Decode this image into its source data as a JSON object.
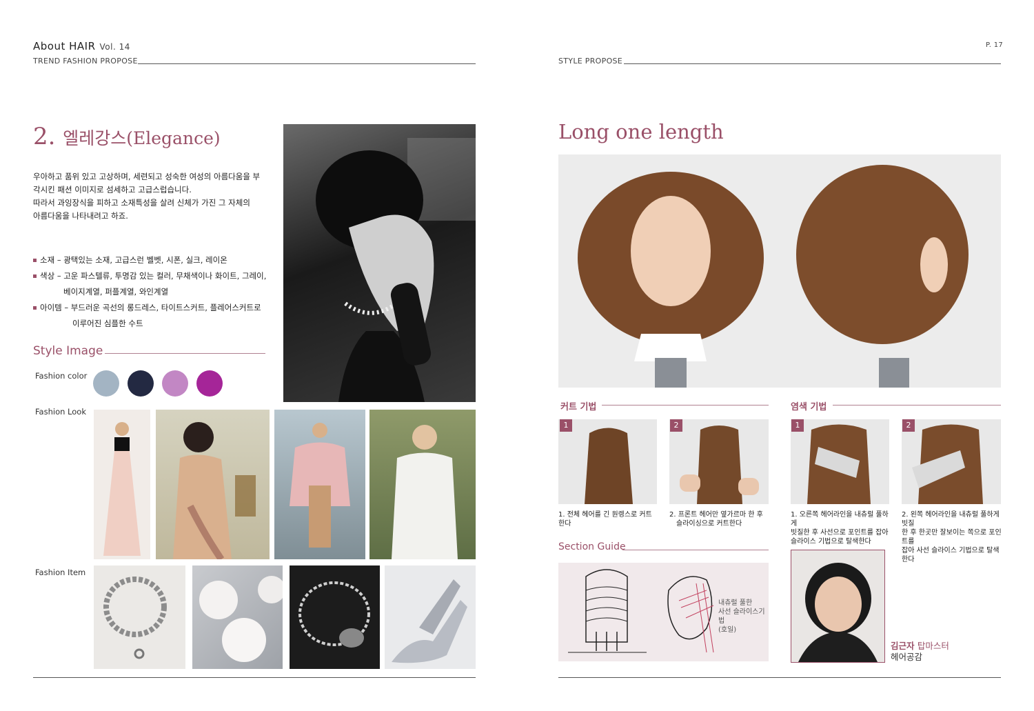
{
  "header_left": {
    "brand": "About HAIR",
    "volume": "Vol. 14",
    "subtitle": "TREND FASHION PROPOSE"
  },
  "header_right": {
    "page": "P. 17",
    "subtitle": "STYLE PROPOSE"
  },
  "left": {
    "heading_number": "2.",
    "heading_text": "엘레강스(Elegance)",
    "intro_lines": [
      "우아하고 품위 있고 고상하며, 세련되고 성숙한 여성의 아름다움을 부",
      "각시킨 패션 이미지로 섬세하고 고급스럽습니다.",
      "따라서 과잉장식을 피하고 소재특성을 살려 신체가 가진 그 자체의",
      "아름다움을 나타내려고 하죠."
    ],
    "bullets": [
      {
        "text": "소재 – 광택있는 소재, 고급스런 벨벳, 시폰, 실크, 레이온",
        "cont": ""
      },
      {
        "text": "색상 – 고운 파스텔류, 투명감 있는 컬러, 무채색이나 화이트, 그레이,",
        "cont": "베이지계열, 퍼플계열, 와인계열"
      },
      {
        "text": "아이템 – 부드러운 곡선의 롱드레스, 타이트스커트, 플레어스커트로",
        "cont": "이루어진 심플한 수트"
      }
    ],
    "style_image_title": "Style Image",
    "fashion_color_label": "Fashion color",
    "fashion_look_label": "Fashion Look",
    "fashion_item_label": "Fashion Item",
    "colors": [
      "#a3b4c3",
      "#232942",
      "#c287c4",
      "#a52598"
    ]
  },
  "right": {
    "title": "Long one length",
    "cut_heading": "커트 기법",
    "color_heading": "염색 기법",
    "cut_steps": [
      {
        "num": "1",
        "caption_lines": [
          "1. 전체 헤어를 긴 원렝스로 커트한다"
        ]
      },
      {
        "num": "2",
        "caption_lines": [
          "2. 프론트 헤어만 옆가르마 한 후",
          "슬라이싱으로 커트한다"
        ]
      }
    ],
    "color_steps": [
      {
        "num": "1",
        "caption_lines": [
          "1. 오른쪽 헤어라인을 내츄럴 풀하게",
          "빗질한 후 사선으로 포인트를 잡아",
          "슬라이스 기법으로 탈색한다"
        ]
      },
      {
        "num": "2",
        "caption_lines": [
          "2. 왼쪽 헤어라인을 내츄럴 풀하게 빗질",
          "한 후 한곳만 잘보이는 쪽으로 포인트를",
          "잡아 사선 슬라이스 기법으로 탈색한다"
        ]
      }
    ],
    "section_guide_title": "Section Guide",
    "guide_note_lines": [
      "내츄럴 풀한",
      "사선 슬라이스기법",
      "(호일)"
    ],
    "master_name": "김근자",
    "master_title": "탑마스터",
    "master_salon": "헤어공감"
  }
}
